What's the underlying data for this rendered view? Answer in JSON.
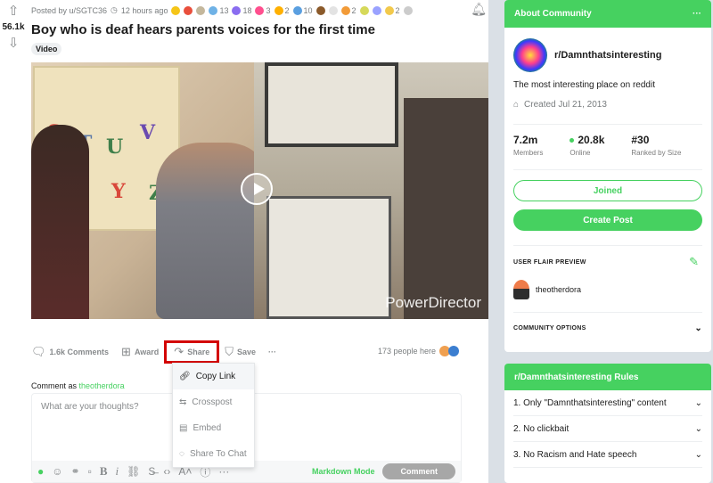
{
  "post": {
    "vote_count": "56.1k",
    "meta_posted": "Posted by u/SGTC36",
    "meta_time": "12 hours ago",
    "award_counts": [
      "13",
      "18",
      "3",
      "2",
      "10",
      "2",
      "2"
    ],
    "title": "Boy who is deaf hears parents voices for the first time",
    "flair": "Video",
    "video_watermark": "PowerDirector"
  },
  "actions": {
    "comments": "1.6k Comments",
    "award": "Award",
    "share": "Share",
    "save": "Save",
    "more": "···",
    "people_here": "173 people here"
  },
  "share_menu": [
    "Copy Link",
    "Crosspost",
    "Embed",
    "Share To Chat"
  ],
  "comment": {
    "comment_as_prefix": "Comment as",
    "username": "theotherdora",
    "placeholder": "What are your thoughts?",
    "markdown_mode": "Markdown Mode",
    "submit": "Comment",
    "more": "···"
  },
  "about": {
    "header": "About Community",
    "header_more": "···",
    "name": "r/Damnthatsinteresting",
    "description": "The most interesting place on reddit",
    "created": "Created Jul 21, 2013",
    "stats": [
      {
        "value": "7.2m",
        "label": "Members"
      },
      {
        "value": "20.8k",
        "label": "Online"
      },
      {
        "value": "#30",
        "label": "Ranked by Size"
      }
    ],
    "joined": "Joined",
    "create_post": "Create Post",
    "flair_preview": "USER FLAIR PREVIEW",
    "flair_username": "theotherdora",
    "community_options": "COMMUNITY OPTIONS"
  },
  "rules": {
    "header": "r/Damnthatsinteresting Rules",
    "items": [
      "1. Only \"Damnthatsinteresting\" content",
      "2. No clickbait",
      "3. No Racism and Hate speech"
    ]
  },
  "colors": {
    "accent": "#46d160",
    "share_highlight": "#d30000"
  }
}
